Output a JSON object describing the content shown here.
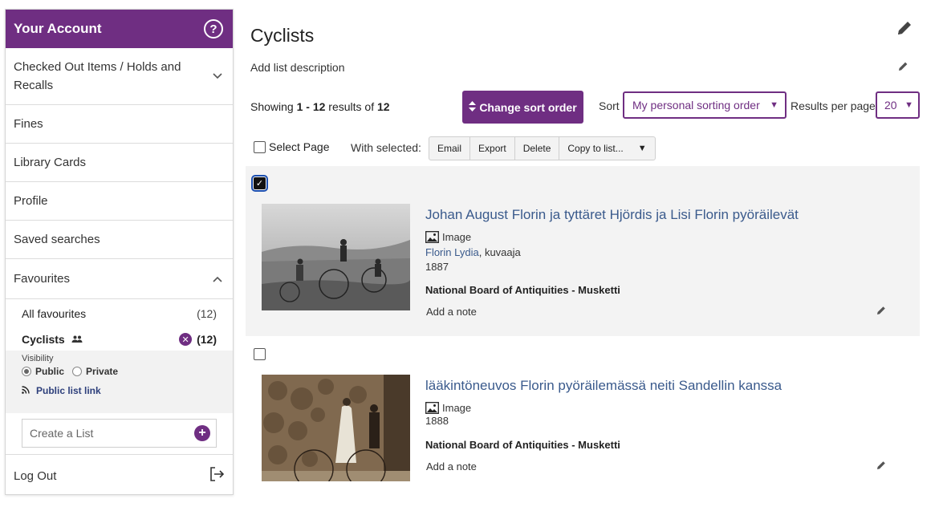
{
  "sidebar": {
    "header_title": "Your Account",
    "help_icon": "question-circle-icon",
    "items": [
      {
        "label": "Checked Out Items / Holds and Recalls"
      },
      {
        "label": "Fines"
      },
      {
        "label": "Library Cards"
      },
      {
        "label": "Profile"
      },
      {
        "label": "Saved searches"
      }
    ],
    "favourites": {
      "label": "Favourites",
      "all_label": "All favourites",
      "all_count": "(12)",
      "current_label": "Cyclists",
      "current_count": "(12)",
      "visibility_label": "Visibility",
      "public_label": "Public",
      "private_label": "Private",
      "visibility_selected": "Public",
      "public_link_label": "Public list link",
      "create_placeholder": "Create a List"
    },
    "logout_label": "Log Out"
  },
  "main": {
    "title": "Cyclists",
    "description_label": "Add list description",
    "showing_prefix": "Showing ",
    "showing_range": "1 - 12",
    "showing_mid": " results of ",
    "showing_total": "12",
    "sort_button_label": "Change sort order",
    "sort_label": "Sort",
    "sort_value": "My personal sorting order",
    "results_per_page_label": "Results per page",
    "results_per_page_value": "20",
    "select_page_label": "Select Page",
    "with_selected_label": "With selected:",
    "actions": {
      "email": "Email",
      "export": "Export",
      "delete": "Delete",
      "copy": "Copy to list..."
    }
  },
  "records": [
    {
      "checked": true,
      "title": "Johan August Florin ja tyttäret Hjördis ja Lisi Florin pyöräilevät",
      "format": "Image",
      "author_link": "Florin Lydia",
      "author_role": ", kuvaaja",
      "year": "1887",
      "source": "National Board of Antiquities - Musketti",
      "note_label": "Add a note"
    },
    {
      "checked": false,
      "title": "lääkintöneuvos Florin pyöräilemässä neiti Sandellin kanssa",
      "format": "Image",
      "year": "1888",
      "source": "National Board of Antiquities - Musketti",
      "note_label": "Add a note"
    }
  ],
  "colors": {
    "accent": "#6f2e82",
    "link": "#3a5a8c",
    "record_highlight": "#f3f3f3"
  }
}
